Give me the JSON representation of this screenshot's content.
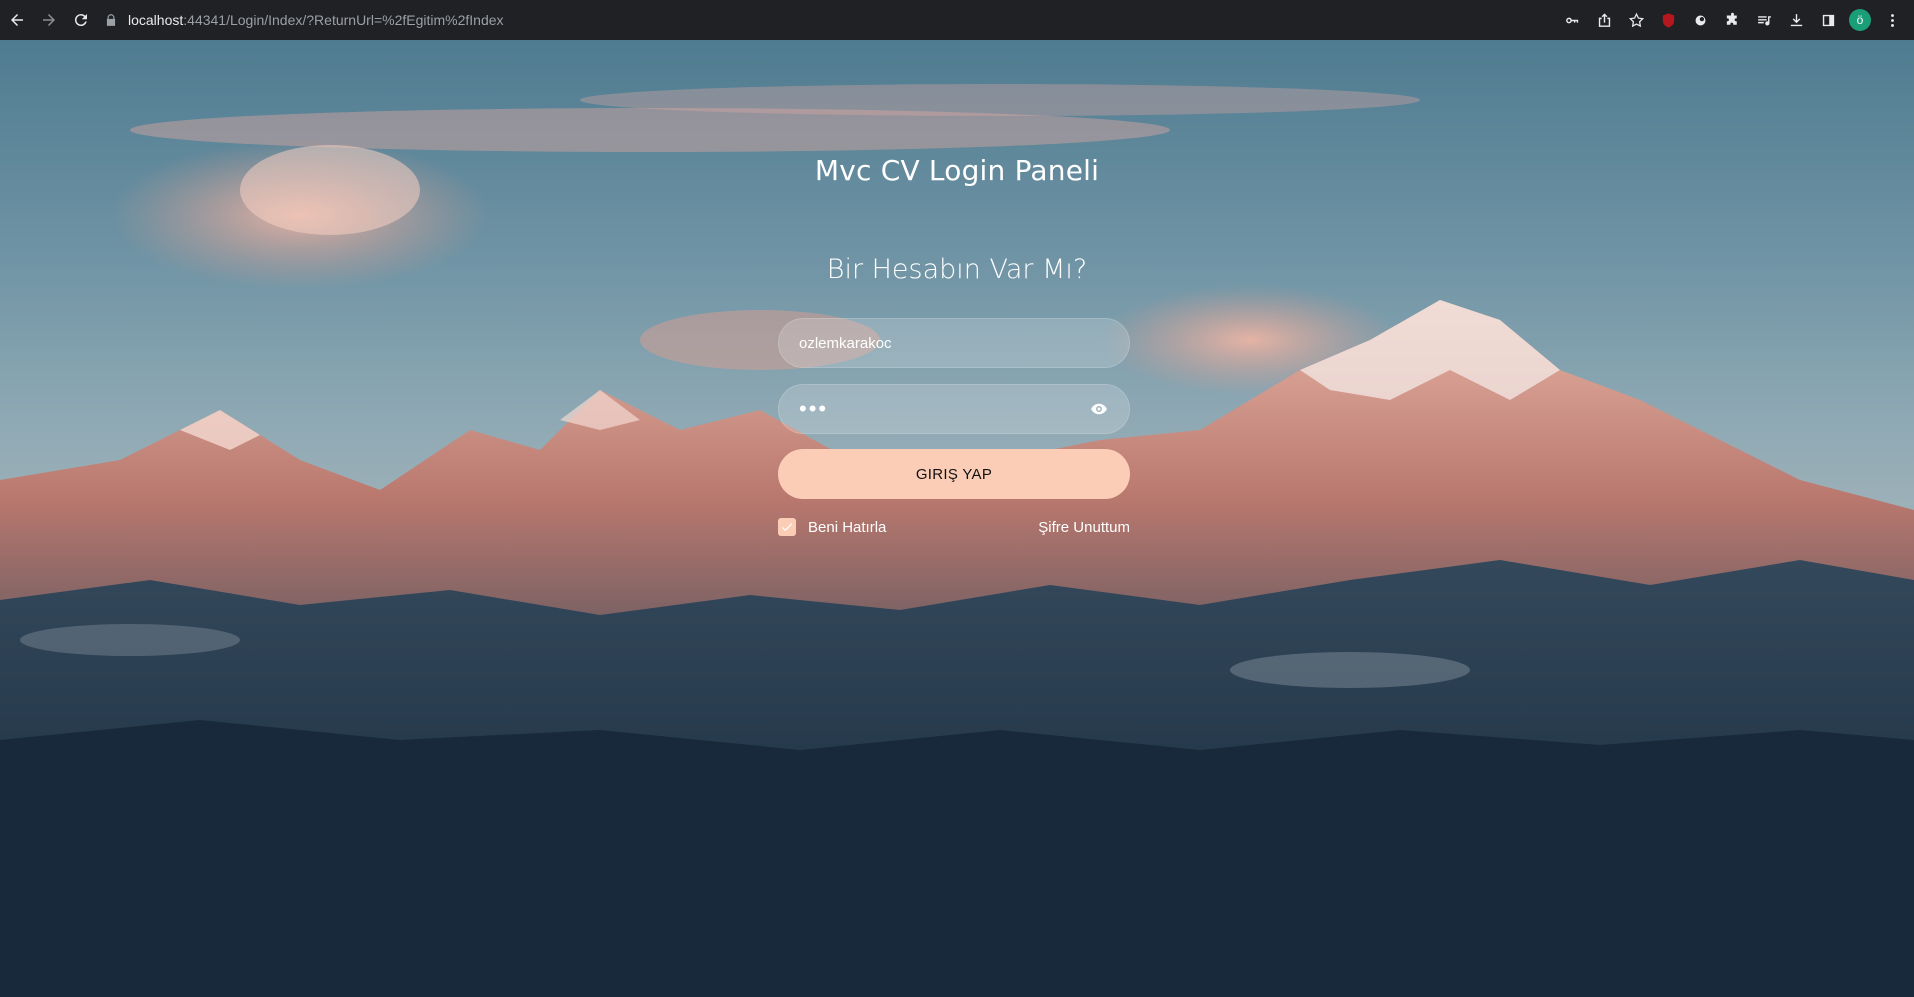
{
  "browser": {
    "url_host": "localhost",
    "url_rest": ":44341/Login/Index/?ReturnUrl=%2fEgitim%2fIndex",
    "profile_initial": "ö",
    "icons": [
      "back-icon",
      "forward-icon",
      "reload-icon",
      "lock-icon",
      "key-icon",
      "share-icon",
      "star-icon",
      "ublock-icon",
      "extension-icon",
      "puzzle-icon",
      "playlist-icon",
      "download-icon",
      "sidepanel-icon",
      "profile-avatar",
      "more-icon"
    ]
  },
  "login": {
    "title": "Mvc CV Login Paneli",
    "subtitle": "Bir Hesabın Var Mı?",
    "username_value": "ozlemkarakoc",
    "password_mask": "•••",
    "submit_label": "GIRIŞ YAP",
    "remember_label": "Beni Hatırla",
    "remember_checked": true,
    "forgot_label": "Şifre Unuttum"
  },
  "colors": {
    "accent": "#fbcdb7",
    "chrome_bg": "#202124",
    "avatar_bg": "#1a9e77"
  }
}
